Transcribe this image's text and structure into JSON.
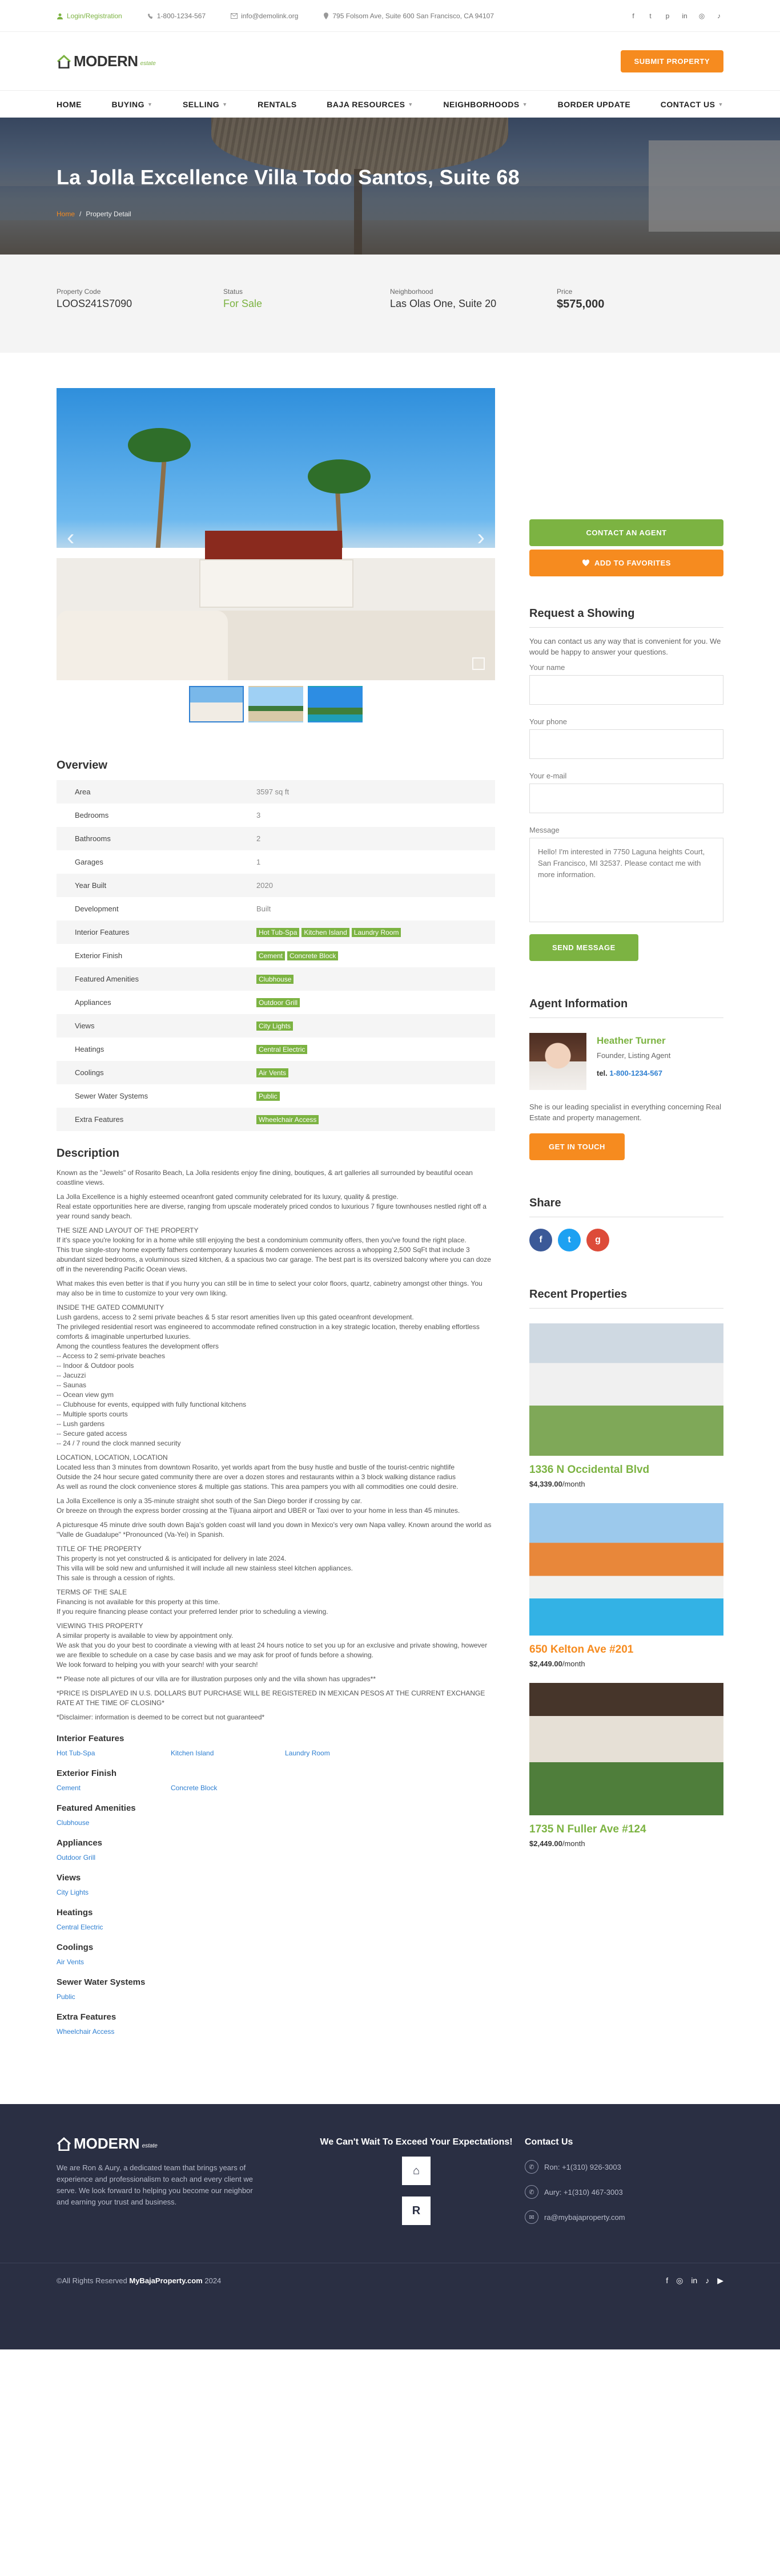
{
  "topbar": {
    "login": "Login/Registration",
    "phone": "1-800-1234-567",
    "email": "info@demolink.org",
    "address": "795 Folsom Ave, Suite 600 San Francisco, CA 94107"
  },
  "header": {
    "logo_main": "MODERN",
    "logo_sub": "estate",
    "submit_label": "SUBMIT PROPERTY"
  },
  "nav": {
    "items": [
      "HOME",
      "BUYING",
      "SELLING",
      "RENTALS",
      "BAJA RESOURCES",
      "NEIGHBORHOODS",
      "BORDER UPDATE",
      "CONTACT US"
    ]
  },
  "hero": {
    "title": "La Jolla Excellence Villa Todo Santos, Suite 68",
    "crumb_home": "Home",
    "crumb_current": "Property Detail"
  },
  "info": {
    "code_label": "Property Code",
    "code": "LOOS241S7090",
    "status_label": "Status",
    "status": "For Sale",
    "neigh_label": "Neighborhood",
    "neigh": "Las Olas One, Suite 20",
    "price_label": "Price",
    "price": "$575,000"
  },
  "overview": {
    "title": "Overview",
    "rows": [
      {
        "k": "Area",
        "v": "3597 sq ft"
      },
      {
        "k": "Bedrooms",
        "v": "3"
      },
      {
        "k": "Bathrooms",
        "v": "2"
      },
      {
        "k": "Garages",
        "v": "1"
      },
      {
        "k": "Year Built",
        "v": "2020"
      },
      {
        "k": "Development",
        "v": "Built"
      },
      {
        "k": "Interior Features",
        "tags": [
          "Hot Tub-Spa",
          "Kitchen Island",
          "Laundry Room"
        ]
      },
      {
        "k": "Exterior Finish",
        "tags": [
          "Cement",
          "Concrete Block"
        ]
      },
      {
        "k": "Featured Amenities",
        "tags": [
          "Clubhouse"
        ]
      },
      {
        "k": "Appliances",
        "tags": [
          "Outdoor Grill"
        ]
      },
      {
        "k": "Views",
        "tags": [
          "City Lights"
        ]
      },
      {
        "k": "Heatings",
        "tags": [
          "Central Electric"
        ]
      },
      {
        "k": "Coolings",
        "tags": [
          "Air Vents"
        ]
      },
      {
        "k": "Sewer Water Systems",
        "tags": [
          "Public"
        ]
      },
      {
        "k": "Extra Features",
        "tags": [
          "Wheelchair Access"
        ]
      }
    ]
  },
  "description": {
    "title": "Description",
    "paragraphs": [
      "Known as the \"Jewels\" of Rosarito Beach, La Jolla residents enjoy fine dining, boutiques, & art galleries all surrounded by beautiful ocean coastline views.",
      "",
      "La Jolla Excellence is a highly esteemed oceanfront gated community celebrated for its luxury, quality & prestige.",
      "Real estate opportunities here are diverse, ranging from upscale moderately priced condos to luxurious 7 figure townhouses nestled right off a year round sandy beach.",
      "",
      "THE SIZE AND LAYOUT OF THE PROPERTY",
      "If it's space you're looking for in a home while still enjoying the best a condominium community offers, then you've found the right place.",
      "This true single-story home expertly fathers contemporary luxuries & modern conveniences across a whopping 2,500 SqFt that include 3 abundant sized bedrooms, a voluminous sized kitchen, & a spacious two car garage. The best part is its oversized balcony where you can doze off in the neverending Pacific Ocean views.",
      "",
      "What makes this even better is that if you hurry you can still be in time to select your color floors, quartz, cabinetry amongst other things. You may also be in time to customize to your very own liking.",
      "",
      "INSIDE THE GATED COMMUNITY",
      "Lush gardens, access to 2 semi private beaches & 5 star resort amenities liven up this gated oceanfront development.",
      "The privileged residential resort was engineered to accommodate refined construction in a key strategic location, thereby enabling effortless comforts & imaginable unperturbed luxuries.",
      "Among the countless features the development offers",
      "-- Access to 2 semi-private beaches",
      "-- Indoor & Outdoor pools",
      "-- Jacuzzi",
      "-- Saunas",
      "-- Ocean view gym",
      "-- Clubhouse for events, equipped with fully functional kitchens",
      "-- Multiple sports courts",
      "-- Lush gardens",
      "-- Secure gated access",
      "-- 24 / 7 round the clock manned security",
      "",
      "LOCATION, LOCATION, LOCATION",
      "Located less than 3 minutes from downtown Rosarito, yet worlds apart from the busy hustle and bustle of the tourist-centric nightlife",
      "Outside the 24 hour secure gated community there are over a dozen stores and restaurants within a 3 block walking distance radius",
      "As well as round the clock convenience stores & multiple gas stations. This area pampers you with all commodities one could desire.",
      "",
      "La Jolla Excellence is only a 35-minute straight shot south of the San Diego border if crossing by car.",
      "Or breeze on through the express border crossing at the Tijuana airport and UBER or Taxi over to your home in less than 45 minutes.",
      "",
      "A picturesque 45 minute drive south down Baja's golden coast will land you down in Mexico's very own Napa valley. Known around the world as \"Valle de Guadalupe\" *Pronounced (Va-Yei) in Spanish.",
      "",
      "TITLE OF THE PROPERTY",
      "This property is not yet constructed & is anticipated for delivery in late 2024.",
      "This villa will be sold new and unfurnished it will include all new stainless steel kitchen appliances.",
      "This sale is through a cession of rights.",
      "",
      "TERMS OF THE SALE",
      "Financing is not available for this property at this time.",
      "If you require financing please contact your preferred lender prior to scheduling a viewing.",
      "",
      "VIEWING THIS PROPERTY",
      "A similar property is available to view by appointment only.",
      "We ask that you do your best to coordinate a viewing with at least 24 hours notice to set you up for an exclusive and private showing, however we are flexible to schedule on a case by case basis and we may ask for proof of funds before a showing.",
      "We look forward to helping you with your search! with your search!",
      "",
      "** Please note all pictures of our villa are for illustration purposes only and the villa shown has upgrades**",
      "",
      "*PRICE IS DISPLAYED IN U.S. DOLLARS BUT PURCHASE WILL BE REGISTERED IN MEXICAN PESOS AT THE CURRENT EXCHANGE RATE AT THE TIME OF CLOSING*",
      "",
      "*Disclaimer: information is deemed to be correct but not guaranteed*"
    ]
  },
  "features": [
    {
      "title": "Interior Features",
      "items": [
        "Hot Tub-Spa",
        "Kitchen Island",
        "Laundry Room"
      ]
    },
    {
      "title": "Exterior Finish",
      "items": [
        "Cement",
        "Concrete Block"
      ]
    },
    {
      "title": "Featured Amenities",
      "items": [
        "Clubhouse"
      ]
    },
    {
      "title": "Appliances",
      "items": [
        "Outdoor Grill"
      ]
    },
    {
      "title": "Views",
      "items": [
        "City Lights"
      ]
    },
    {
      "title": "Heatings",
      "items": [
        "Central Electric"
      ]
    },
    {
      "title": "Coolings",
      "items": [
        "Air Vents"
      ]
    },
    {
      "title": "Sewer Water Systems",
      "items": [
        "Public"
      ]
    },
    {
      "title": "Extra Features",
      "items": [
        "Wheelchair Access"
      ]
    }
  ],
  "sidebar": {
    "contact_agent": "CONTACT AN AGENT",
    "add_fav": "ADD TO FAVORITES",
    "showing_title": "Request a Showing",
    "showing_note": "You can contact us any way that is convenient for you. We would be happy to answer your questions.",
    "name_label": "Your name",
    "phone_label": "Your phone",
    "email_label": "Your e-mail",
    "message_label": "Message",
    "message_placeholder": "Hello! I'm interested in 7750 Laguna heights Court, San Francisco, MI 32537. Please contact me with more information.",
    "send_label": "SEND MESSAGE",
    "agent_title": "Agent Information",
    "agent_name": "Heather Turner",
    "agent_role": "Founder, Listing Agent",
    "agent_tel_label": "tel.",
    "agent_tel": "1-800-1234-567",
    "agent_bio": "She is our leading specialist in everything concerning Real Estate and property management.",
    "touch_label": "GET IN TOUCH",
    "share_title": "Share",
    "recent_title": "Recent Properties",
    "recent": [
      {
        "title": "1336 N Occidental Blvd",
        "price": "$4,339.00",
        "period": "/month"
      },
      {
        "title": "650 Kelton Ave #201",
        "price": "$2,449.00",
        "period": "/month"
      },
      {
        "title": "1735 N Fuller Ave #124",
        "price": "$2,449.00",
        "period": "/month"
      }
    ]
  },
  "footer": {
    "logo_main": "MODERN",
    "logo_sub": "estate",
    "about": "We are Ron & Aury, a dedicated team that brings years of experience and professionalism to each and every client we serve. We look forward to helping you become our neighbor and earning your trust and business.",
    "mid_title": "We Can't Wait To Exceed Your Expectations!",
    "contact_title": "Contact Us",
    "contact_ron": "Ron: +1(310) 926-3003",
    "contact_aury": "Aury: +1(310) 467-3003",
    "contact_email": "ra@mybajaproperty.com",
    "copyright_pre": "©All Rights Reserved",
    "copyright_brand": "MyBajaProperty.com",
    "copyright_year": "2024"
  },
  "colors": {
    "green": "#7cb342",
    "orange": "#f68b1f",
    "link": "#2e7fd1",
    "footer": "#2a2f43"
  }
}
